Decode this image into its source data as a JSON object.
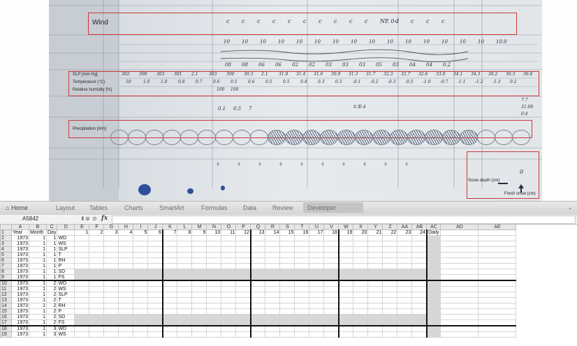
{
  "scan": {
    "wind_label": "Wind",
    "slp_label": "SLP [mm Hg]",
    "temp_label": "Temperature (°C)",
    "rh_label": "Relative humidity [%]",
    "precip_label": "Precipitation [mm]",
    "snow_depth_label": "Snow depth (cm)",
    "fresh_snow_label": "Fresh snow (cm)",
    "wind_row": [
      "c",
      "c",
      "c",
      "c",
      "c",
      "c",
      "c",
      "c",
      "c",
      "c",
      "NE 0-1",
      "c",
      "c",
      "c",
      "c"
    ],
    "row2": [
      "10",
      "10",
      "10",
      "10",
      "10",
      "10",
      "10",
      "10",
      "10",
      "10",
      "10",
      "10",
      "10",
      "10",
      "10",
      "10.0"
    ],
    "row3": [
      "08",
      "08",
      "06",
      "06",
      "02",
      "02",
      "03",
      "03",
      "03",
      "05",
      "03",
      "04",
      "04",
      "0.2"
    ],
    "slp_row": [
      "302",
      "300",
      "303",
      "301",
      "2.1",
      "303",
      "300",
      "30.3",
      "2.1",
      "31.8",
      "31.4",
      "31.6",
      "30.9",
      "31.3",
      "31.7",
      "32.3",
      "32.7",
      "32.6",
      "33.8",
      "34.1",
      "34.3",
      "36.2",
      "36.3",
      "36.8"
    ],
    "temp_row": [
      "10",
      "1.0",
      "1.0",
      "0.8",
      "0.7",
      "0.6",
      "0.5",
      "0.6",
      "0.5",
      "0.5",
      "0.4",
      "0.3",
      "0.3",
      "-0.1",
      "-0.2",
      "-0.3",
      "-0.5",
      "-1.0",
      "-0.7",
      "-1.1",
      "-1.2",
      "-1.3",
      "0.2"
    ],
    "rh_row": [
      "100",
      "100"
    ],
    "precip_marks": [
      "0.1",
      "0.5",
      "7"
    ],
    "precip_marks2": [
      "0.5",
      "0.4"
    ],
    "right_marks": [
      "7.7",
      "31.08",
      "0.4"
    ],
    "snow_value": "0"
  },
  "ribbon": {
    "tabs": [
      "Home",
      "Layout",
      "Tables",
      "Charts",
      "SmartArt",
      "Formulas",
      "Data",
      "Review",
      "Developer"
    ],
    "active_tab": "Home",
    "home_icon": "home-icon",
    "collapse_icon": "chevron-icon"
  },
  "formula_bar": {
    "cell_ref": "A5842",
    "fx": "fx",
    "formula_value": ""
  },
  "sheet": {
    "columns": [
      "A",
      "B",
      "C",
      "D",
      "E",
      "F",
      "G",
      "H",
      "I",
      "J",
      "K",
      "L",
      "M",
      "N",
      "O",
      "P",
      "Q",
      "R",
      "S",
      "T",
      "U",
      "V",
      "W",
      "X",
      "Y",
      "Z",
      "AA",
      "AB",
      "AC",
      "AD",
      "AE"
    ],
    "header_row": [
      "Year",
      "Month",
      "Day",
      "",
      "1",
      "2",
      "3",
      "4",
      "5",
      "6",
      "7",
      "8",
      "9",
      "10",
      "11",
      "12",
      "13",
      "14",
      "15",
      "16",
      "17",
      "18",
      "19",
      "20",
      "21",
      "22",
      "23",
      "24",
      "Daily",
      "",
      ""
    ],
    "rows": [
      {
        "n": "2",
        "year": "1973",
        "month": "1",
        "day": "1",
        "var": "WD"
      },
      {
        "n": "3",
        "year": "1973",
        "month": "1",
        "day": "1",
        "var": "WS"
      },
      {
        "n": "4",
        "year": "1973",
        "month": "1",
        "day": "1",
        "var": "SLP"
      },
      {
        "n": "5",
        "year": "1973",
        "month": "1",
        "day": "1",
        "var": "T"
      },
      {
        "n": "6",
        "year": "1973",
        "month": "1",
        "day": "1",
        "var": "RH"
      },
      {
        "n": "7",
        "year": "1973",
        "month": "1",
        "day": "1",
        "var": "P"
      },
      {
        "n": "8",
        "year": "1973",
        "month": "1",
        "day": "1",
        "var": "SD"
      },
      {
        "n": "9",
        "year": "1973",
        "month": "1",
        "day": "1",
        "var": "FS"
      },
      {
        "n": "10",
        "year": "1973",
        "month": "1",
        "day": "2",
        "var": "WD"
      },
      {
        "n": "11",
        "year": "1973",
        "month": "1",
        "day": "2",
        "var": "WS"
      },
      {
        "n": "12",
        "year": "1973",
        "month": "1",
        "day": "2",
        "var": "SLP"
      },
      {
        "n": "13",
        "year": "1973",
        "month": "1",
        "day": "2",
        "var": "T"
      },
      {
        "n": "14",
        "year": "1973",
        "month": "1",
        "day": "2",
        "var": "RH"
      },
      {
        "n": "15",
        "year": "1973",
        "month": "1",
        "day": "2",
        "var": "P"
      },
      {
        "n": "16",
        "year": "1973",
        "month": "1",
        "day": "2",
        "var": "SD"
      },
      {
        "n": "17",
        "year": "1973",
        "month": "1",
        "day": "2",
        "var": "FS"
      },
      {
        "n": "18",
        "year": "1973",
        "month": "1",
        "day": "3",
        "var": "WD"
      },
      {
        "n": "19",
        "year": "1973",
        "month": "1",
        "day": "3",
        "var": "WS"
      }
    ]
  }
}
